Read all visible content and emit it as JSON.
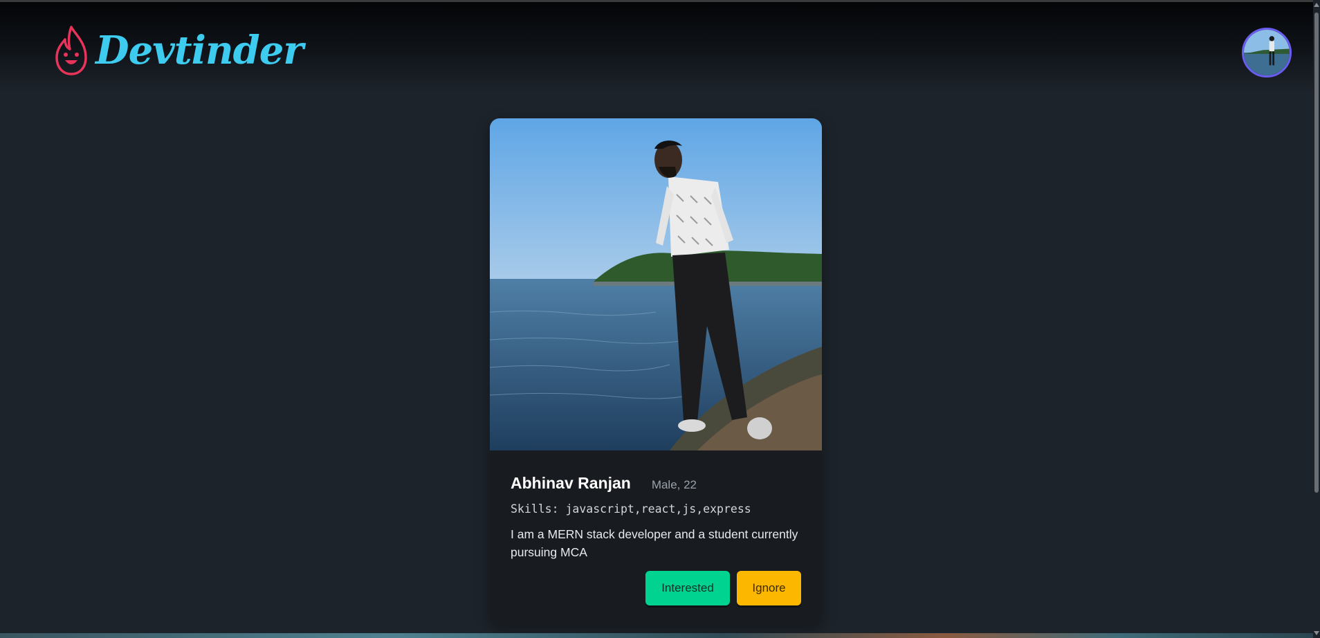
{
  "navbar": {
    "logo_text": "Devtinder",
    "logo_icon": "flame-face-icon",
    "avatar_icon": "user-avatar-photo"
  },
  "card": {
    "photo_icon": "profile-photo",
    "name": "Abhinav Ranjan",
    "meta": "Male, 22",
    "skills": "Skills: javascript,react,js,express",
    "about": "I am a MERN stack developer and a student currently pursuing MCA",
    "interested_label": "Interested",
    "ignore_label": "Ignore"
  },
  "colors": {
    "background": "#1d232a",
    "logo_text": "#3ecbf0",
    "logo_icon": "#e8345b",
    "interested": "#00d390",
    "ignore": "#fcb700",
    "avatar_ring": "#6a5cf0"
  }
}
